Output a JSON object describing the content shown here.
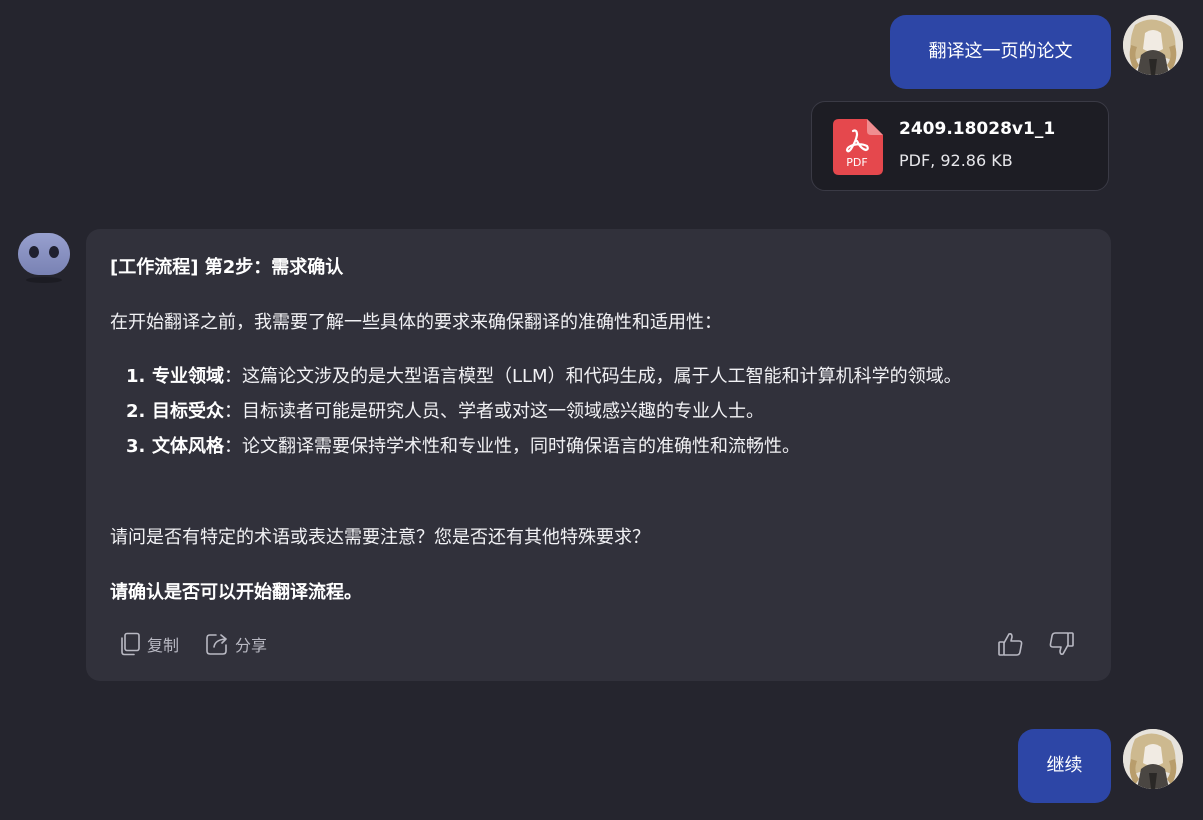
{
  "messages": {
    "user_first": "翻译这一页的论文",
    "user_second": "继续"
  },
  "attachment": {
    "icon": "pdf-file-icon",
    "icon_label": "PDF",
    "name": "2409.18028v1_1",
    "meta": "PDF, 92.86 KB"
  },
  "assistant": {
    "heading": "[工作流程] 第2步：需求确认",
    "intro": "在开始翻译之前，我需要了解一些具体的要求来确保翻译的准确性和适用性：",
    "requirements": [
      {
        "num": "1.",
        "term": "专业领域",
        "text": "：这篇论文涉及的是大型语言模型（LLM）和代码生成，属于人工智能和计算机科学的领域。"
      },
      {
        "num": "2.",
        "term": "目标受众",
        "text": "：目标读者可能是研究人员、学者或对这一领域感兴趣的专业人士。"
      },
      {
        "num": "3.",
        "term": "文体风格",
        "text": "：论文翻译需要保持学术性和专业性，同时确保语言的准确性和流畅性。"
      }
    ],
    "question": "请问是否有特定的术语或表达需要注意？您是否还有其他特殊要求？",
    "confirm": "请确认是否可以开始翻译流程。",
    "actions": {
      "copy_label": "复制",
      "share_label": "分享"
    }
  },
  "colors": {
    "background": "#25252e",
    "user_bubble": "#2d46a6",
    "assistant_card": "#31313b",
    "file_card": "#1d1d24",
    "pdf_red": "#e5484d"
  }
}
